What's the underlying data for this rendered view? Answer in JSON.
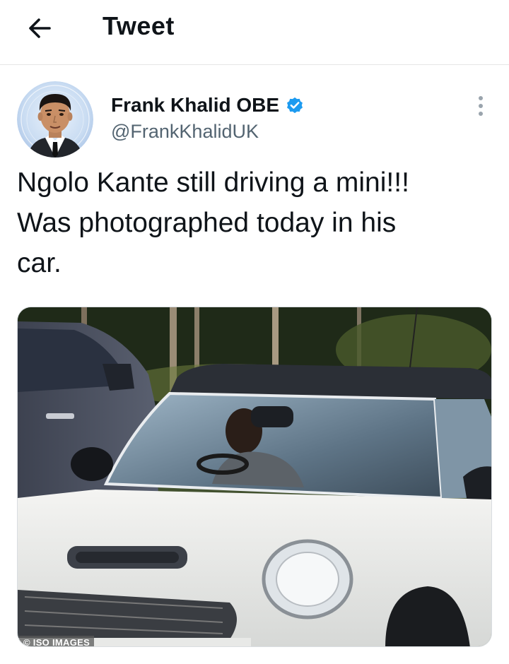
{
  "header": {
    "title": "Tweet",
    "back_icon": "arrow-left-icon"
  },
  "tweet": {
    "author": {
      "name": "Frank Khalid OBE",
      "handle": "@FrankKhalidUK",
      "verified": true,
      "verified_color": "#1d9bf0"
    },
    "text": "Ngolo Kante still driving a mini!!!\nWas photographed today in his\ncar.",
    "media": {
      "credit": "© ISO IMAGES"
    },
    "more_icon": "more-vertical-icon"
  },
  "colors": {
    "text_primary": "#0f1419",
    "text_secondary": "#536471",
    "accent": "#1d9bf0",
    "divider": "#e6e6e6"
  }
}
